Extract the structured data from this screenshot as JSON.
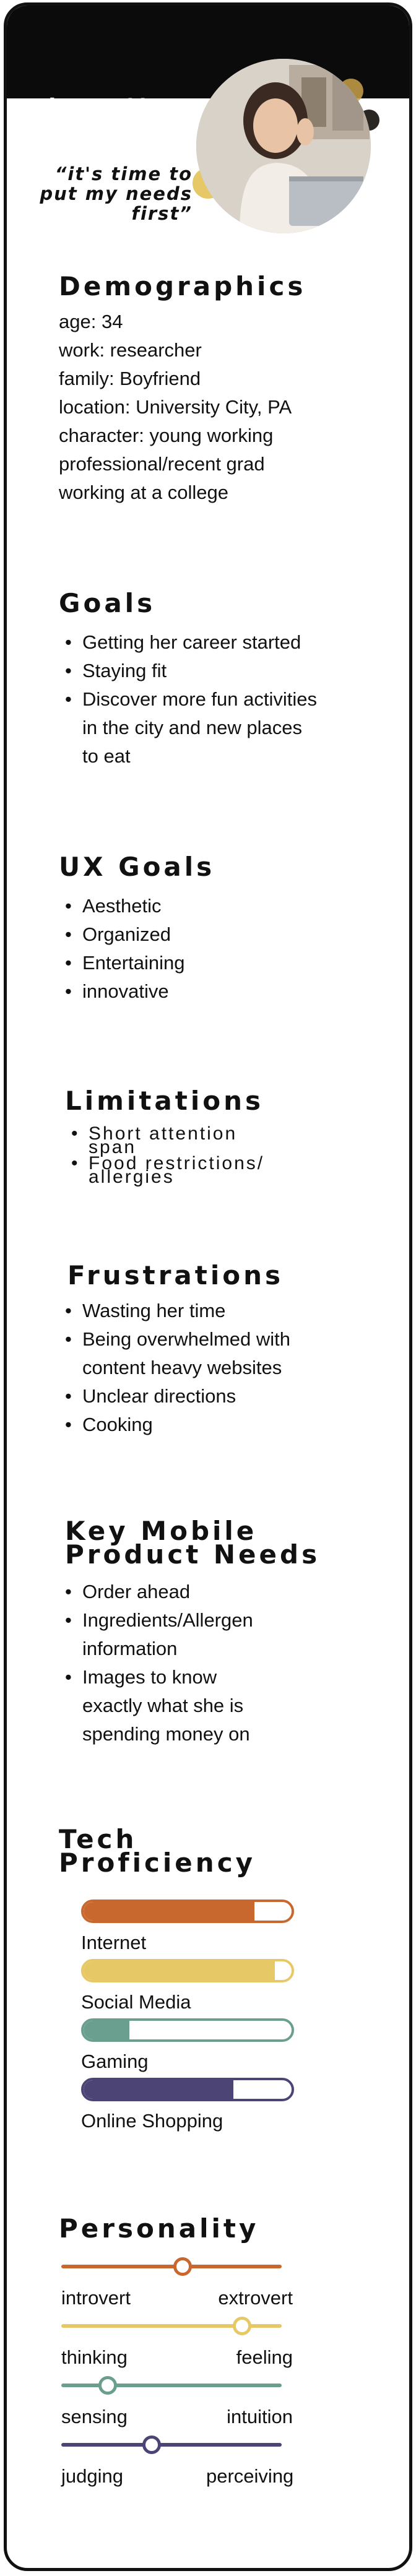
{
  "persona": {
    "name_first": "Jennette",
    "name_last": "Samson",
    "quote_line1": "“it's time to",
    "quote_line2": "put my needs",
    "quote_line3": "first”"
  },
  "demographics": {
    "title": "Demographics",
    "lines": [
      "age: 34",
      "work: researcher",
      "family: Boyfriend",
      "location: University City, PA",
      "character: young working",
      "professional/recent grad",
      "working at a college"
    ]
  },
  "goals": {
    "title": "Goals",
    "items": [
      [
        "Getting her career started"
      ],
      [
        "Staying fit"
      ],
      [
        "Discover more fun activities",
        "in the city and new places",
        "to eat"
      ]
    ]
  },
  "ux_goals": {
    "title": "UX Goals",
    "items": [
      "Aesthetic",
      "Organized",
      "Entertaining",
      "innovative"
    ]
  },
  "limitations": {
    "title": "Limitations",
    "items": [
      [
        "Short attention",
        "span"
      ],
      [
        "Food restrictions/",
        "allergies"
      ]
    ]
  },
  "frustrations": {
    "title": "Frustrations",
    "items": [
      [
        "Wasting her time"
      ],
      [
        "Being overwhelmed with",
        "content heavy websites"
      ],
      [
        "Unclear directions"
      ],
      [
        "Cooking"
      ]
    ]
  },
  "mobile_needs": {
    "title_line1": "Key Mobile",
    "title_line2": "Product Needs",
    "items": [
      [
        "Order ahead"
      ],
      [
        "Ingredients/Allergen",
        "information"
      ],
      [
        "Images to know",
        "exactly what she is",
        "spending money on"
      ]
    ]
  },
  "tech": {
    "title_line1": "Tech",
    "title_line2": "Proficiency",
    "bars": [
      {
        "label": "Internet",
        "level": 0.82,
        "color": "#c8682e"
      },
      {
        "label": "Social Media",
        "level": 0.92,
        "color": "#e6c866"
      },
      {
        "label": "Gaming",
        "level": 0.22,
        "color": "#6a9e8e"
      },
      {
        "label": "Online Shopping",
        "level": 0.72,
        "color": "#4b4474"
      }
    ]
  },
  "personality": {
    "title": "Personality",
    "scales": [
      {
        "left": "introvert",
        "right": "extrovert",
        "level": 0.55,
        "color": "#c8682e"
      },
      {
        "left": "thinking",
        "right": "feeling",
        "level": 0.82,
        "color": "#e6c866"
      },
      {
        "left": "sensing",
        "right": "intuition",
        "level": 0.21,
        "color": "#6a9e8e"
      },
      {
        "left": "judging",
        "right": "perceiving",
        "level": 0.41,
        "color": "#4b4474"
      }
    ]
  }
}
